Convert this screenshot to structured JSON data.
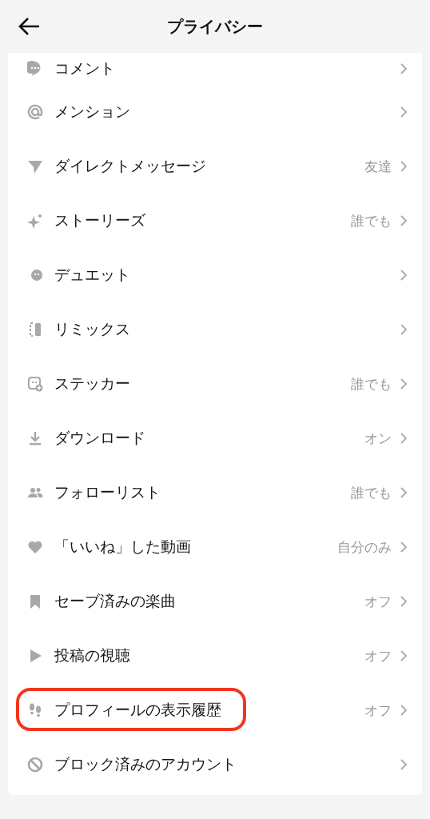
{
  "header": {
    "title": "プライバシー"
  },
  "rows": [
    {
      "label": "コメント",
      "highlighted": false
    },
    {
      "label": "メンション",
      "highlighted": false
    },
    {
      "label": "ダイレクトメッセージ",
      "value": "友達",
      "highlighted": false
    },
    {
      "label": "ストーリーズ",
      "value": "誰でも",
      "highlighted": false
    },
    {
      "label": "デュエット",
      "highlighted": false
    },
    {
      "label": "リミックス",
      "highlighted": false
    },
    {
      "label": "ステッカー",
      "value": "誰でも",
      "highlighted": false
    },
    {
      "label": "ダウンロード",
      "value": "オン",
      "highlighted": false
    },
    {
      "label": "フォローリスト",
      "value": "誰でも",
      "highlighted": false
    },
    {
      "label": "「いいね」した動画",
      "value": "自分のみ",
      "highlighted": false
    },
    {
      "label": "セーブ済みの楽曲",
      "value": "オフ",
      "highlighted": false
    },
    {
      "label": "投稿の視聴",
      "value": "オフ",
      "highlighted": false
    },
    {
      "label": "プロフィールの表示履歴",
      "value": "オフ",
      "highlighted": true
    },
    {
      "label": "ブロック済みのアカウント",
      "highlighted": false
    }
  ]
}
